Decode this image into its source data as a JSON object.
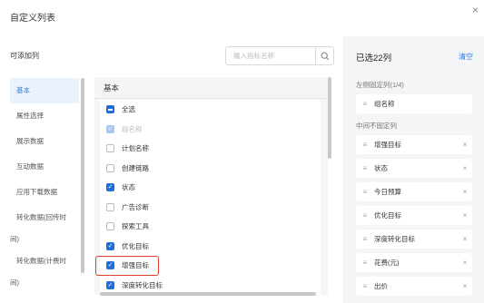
{
  "dialog": {
    "title": "自定义列表",
    "close_icon": "×"
  },
  "available": {
    "label": "可添加列",
    "search": {
      "placeholder": "输入指标名称",
      "value": ""
    }
  },
  "categories": [
    "基本",
    "属性选择",
    "展示数据",
    "互动数据",
    "应用下载数据",
    "转化数据(回传时",
    "间)",
    "转化数据(计费时",
    "间)"
  ],
  "list": {
    "header": "基本",
    "items": [
      {
        "label": "全选",
        "state": "indeterminate"
      },
      {
        "label": "组名称",
        "state": "disabled-checked"
      },
      {
        "label": "计划名称",
        "state": "unchecked"
      },
      {
        "label": "创建链路",
        "state": "unchecked"
      },
      {
        "label": "状态",
        "state": "checked"
      },
      {
        "label": "广告诊断",
        "state": "unchecked"
      },
      {
        "label": "探索工具",
        "state": "unchecked"
      },
      {
        "label": "优化目标",
        "state": "checked"
      },
      {
        "label": "增强目标",
        "state": "checked"
      },
      {
        "label": "深度转化目标",
        "state": "checked"
      }
    ]
  },
  "selected": {
    "title": "已选22列",
    "clear_label": "清空",
    "fixed_label": "左侧固定列(1/4)",
    "fixed_items": [
      {
        "label": "组名称"
      }
    ],
    "unfixed_label": "中间不固定列",
    "unfixed_items": [
      {
        "label": "增强目标"
      },
      {
        "label": "状态"
      },
      {
        "label": "今日预算"
      },
      {
        "label": "优化目标"
      },
      {
        "label": "深度转化目标"
      },
      {
        "label": "花费(元)"
      },
      {
        "label": "出价"
      }
    ],
    "remove_icon": "×",
    "drag_icon": "≡"
  },
  "colors": {
    "accent": "#1e6fd9",
    "link": "#2a7de1",
    "highlight_border": "#e03c31",
    "panel_bg": "#f4f5f7"
  }
}
